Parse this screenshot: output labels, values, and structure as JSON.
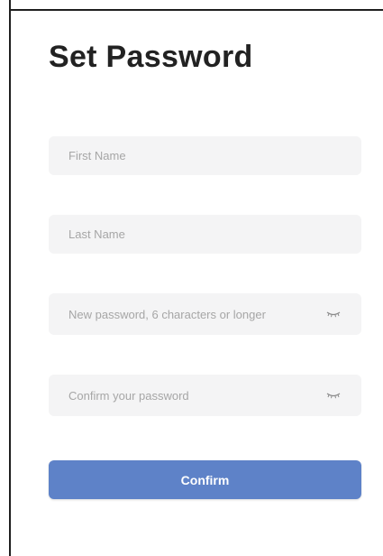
{
  "header": {
    "title": "Set Password"
  },
  "form": {
    "first_name": {
      "placeholder": "First Name",
      "value": ""
    },
    "last_name": {
      "placeholder": "Last Name",
      "value": ""
    },
    "new_password": {
      "placeholder": "New password, 6 characters or longer",
      "value": "",
      "toggle_icon": "eye-closed-icon"
    },
    "confirm_password": {
      "placeholder": "Confirm your password",
      "value": "",
      "toggle_icon": "eye-closed-icon"
    }
  },
  "actions": {
    "confirm_label": "Confirm"
  },
  "colors": {
    "accent": "#5e82c8",
    "field_background": "#f4f4f5",
    "placeholder": "#a6a6a6",
    "title": "#222222"
  }
}
